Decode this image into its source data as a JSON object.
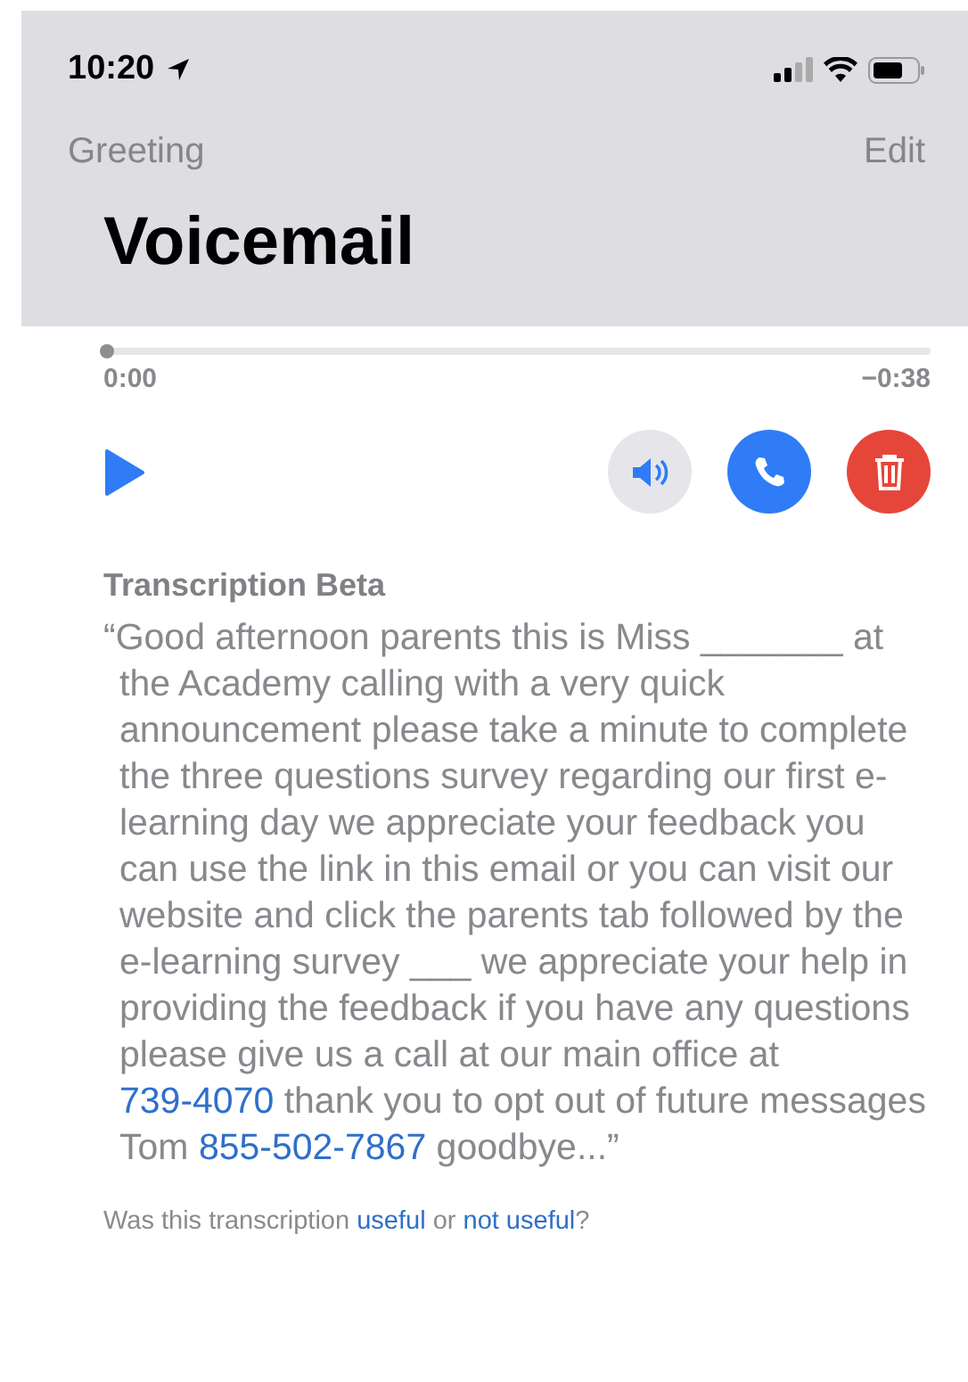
{
  "status_bar": {
    "time": "10:20"
  },
  "nav": {
    "left": "Greeting",
    "right": "Edit",
    "title": "Voicemail"
  },
  "player": {
    "level": 0,
    "elapsed": "0:00",
    "remaining": "−0:38"
  },
  "transcription": {
    "heading": "Transcription Beta",
    "segments": [
      {
        "kind": "text",
        "text": "“Good afternoon parents this is Miss _______ at the Academy calling with a very quick announcement please take a minute to complete the three questions survey regarding our first e-learning day we appreciate your feedback you can use the link in this email or you can visit our website and click the parents tab followed by the e-learning survey ___ we appreciate your help in providing the feedback if you have any questions please give us a call at our main office at "
      },
      {
        "kind": "link",
        "text": "739-4070"
      },
      {
        "kind": "text",
        "text": " thank you to opt out of future messages Tom "
      },
      {
        "kind": "link",
        "text": "855-502-7867"
      },
      {
        "kind": "text",
        "text": " goodbye...”"
      }
    ]
  },
  "feedback": [
    {
      "kind": "text",
      "text": "Was this transcription "
    },
    {
      "kind": "link",
      "text": "useful"
    },
    {
      "kind": "text",
      "text": " or "
    },
    {
      "kind": "link",
      "text": "not useful"
    },
    {
      "kind": "text",
      "text": "?"
    }
  ]
}
